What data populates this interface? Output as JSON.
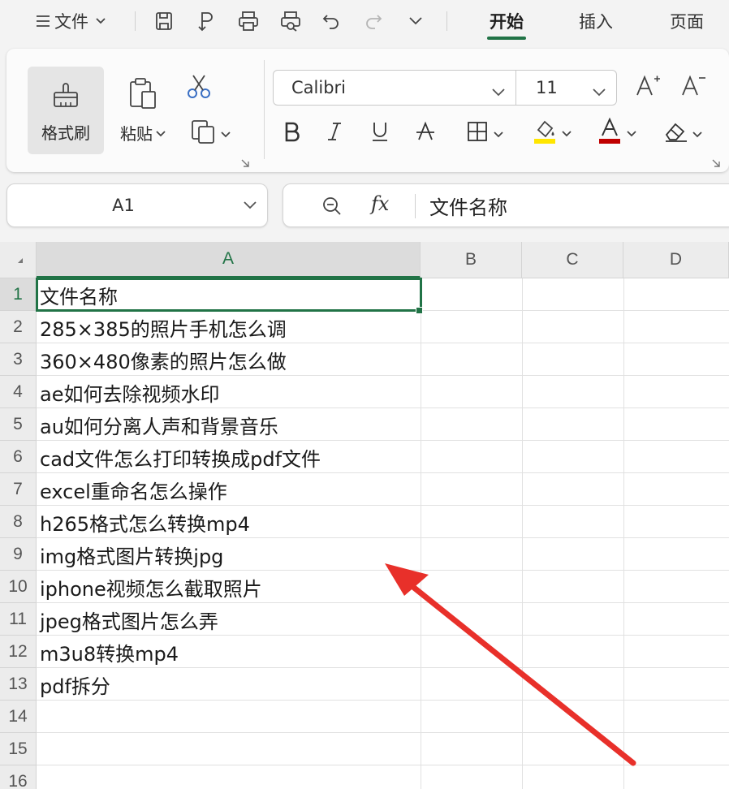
{
  "menubar": {
    "file_label": "文件",
    "tabs": [
      {
        "label": "开始",
        "active": true
      },
      {
        "label": "插入",
        "active": false
      },
      {
        "label": "页面",
        "active": false
      }
    ]
  },
  "ribbon": {
    "format_painter_label": "格式刷",
    "paste_label": "粘贴",
    "font_name": "Calibri",
    "font_size": "11",
    "font_color": "#c00000",
    "highlight_color": "#ffe600"
  },
  "name_box": {
    "value": "A1"
  },
  "formula_bar": {
    "value": "文件名称"
  },
  "grid": {
    "columns": [
      "A",
      "B",
      "C",
      "D"
    ],
    "rows": [
      "1",
      "2",
      "3",
      "4",
      "5",
      "6",
      "7",
      "8",
      "9",
      "10",
      "11",
      "12",
      "13",
      "14",
      "15",
      "16"
    ],
    "selected_cell": "A1",
    "column_a_values": [
      "文件名称",
      "285×385的照片手机怎么调",
      "360×480像素的照片怎么做",
      "ae如何去除视频水印",
      "au如何分离人声和背景音乐",
      "cad文件怎么打印转换成pdf文件",
      "excel重命名怎么操作",
      "h265格式怎么转换mp4",
      "img格式图片转换jpg",
      "iphone视频怎么截取照片",
      "jpeg格式图片怎么弄",
      "m3u8转换mp4",
      "pdf拆分"
    ]
  },
  "colors": {
    "accent": "#217346",
    "annotation_arrow": "#e8302a"
  }
}
